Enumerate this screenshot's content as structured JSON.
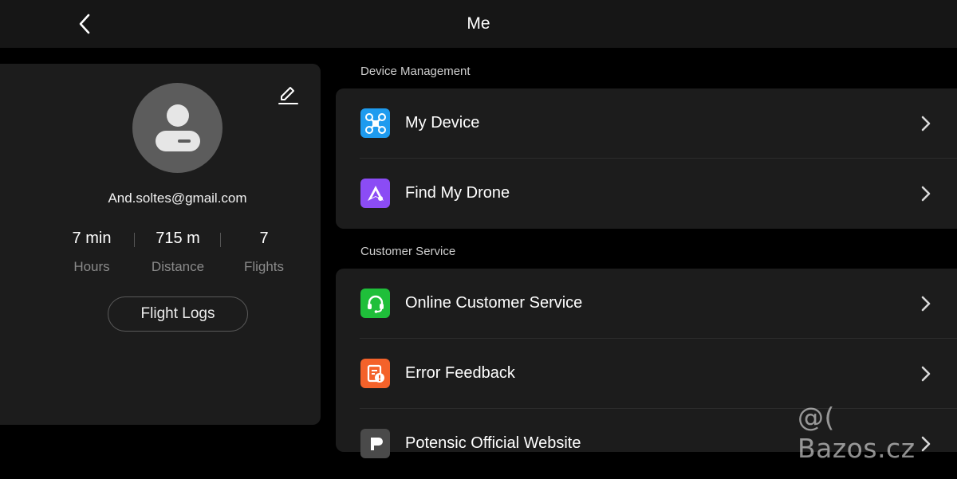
{
  "header": {
    "title": "Me"
  },
  "profile": {
    "email": "And.soltes@gmail.com",
    "stats": [
      {
        "value": "7 min",
        "label": "Hours"
      },
      {
        "value": "715 m",
        "label": "Distance"
      },
      {
        "value": "7",
        "label": "Flights"
      }
    ],
    "flight_logs_label": "Flight Logs"
  },
  "sections": {
    "device_management": {
      "label": "Device Management",
      "items": [
        {
          "label": "My Device",
          "icon": "drone-icon",
          "color": "#1e9bef"
        },
        {
          "label": "Find My Drone",
          "icon": "find-drone-icon",
          "color": "#8b4cf5"
        }
      ]
    },
    "customer_service": {
      "label": "Customer Service",
      "items": [
        {
          "label": "Online Customer Service",
          "icon": "headset-icon",
          "color": "#1fbf3a"
        },
        {
          "label": "Error Feedback",
          "icon": "error-report-icon",
          "color": "#f4622a"
        },
        {
          "label": "Potensic Official Website",
          "icon": "website-icon",
          "color": "#4a4a4a"
        }
      ]
    }
  },
  "watermark": "@( Bazos.cz"
}
